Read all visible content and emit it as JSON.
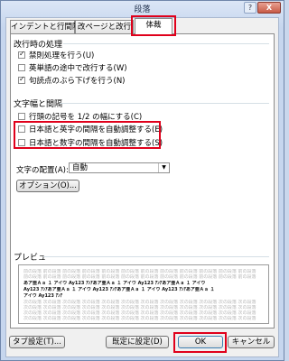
{
  "window": {
    "title": "段落",
    "help": "?",
    "close": "X"
  },
  "tabs": [
    {
      "label": "インデントと行間隔"
    },
    {
      "label": "改ページと改行"
    },
    {
      "label": "体裁"
    }
  ],
  "line_break": {
    "heading": "改行時の処理",
    "options": [
      {
        "label": "禁則処理を行う(U)",
        "checked": true
      },
      {
        "label": "英単語の途中で改行する(W)",
        "checked": false
      },
      {
        "label": "句読点のぶら下げを行う(N)",
        "checked": true
      }
    ]
  },
  "spacing": {
    "heading": "文字幅と間隔",
    "options": [
      {
        "label": "行頭の記号を 1/2 の幅にする(C)",
        "checked": false
      },
      {
        "label": "日本語と英字の間隔を自動調整する(E)",
        "checked": false
      },
      {
        "label": "日本語と数字の間隔を自動調整する(S)",
        "checked": false
      }
    ],
    "align_label": "文字の配置(A):",
    "align_value": "自動",
    "options_button": "オプション(O)..."
  },
  "preview": {
    "heading": "プレビュー",
    "grey_text": "前の段落 前の段落 前の段落 前の段落 前の段落 前の段落 前の段落 前の段落 前の段落 前の段落 前の段落 前の段落",
    "grey_text_next": "次の段落 次の段落 次の段落 次の段落 次の段落 次の段落 次の段落 次の段落 次の段落 次の段落 次の段落 次の段落",
    "sample_1": "あア亜Ａａ １ アイウ Ay123 ｱﾝｱあア亜Ａａ １ アイウ Ay123 ｱﾝｱあア亜Ａａ １ アイウ",
    "sample_2": "Ay123 ｱﾝｱあア亜Ａａ １ アイウ Ay123 ｱﾝｱあア亜Ａａ １ アイウ Ay123 ｱﾝｱあア亜Ａａ １",
    "sample_3": "アイウ Ay123 ｱﾝｱ"
  },
  "buttons": {
    "tabs": "タブ設定(T)...",
    "default": "既定に設定(D)",
    "ok": "OK",
    "cancel": "キャンセル"
  },
  "highlight_color": "#e0001b"
}
